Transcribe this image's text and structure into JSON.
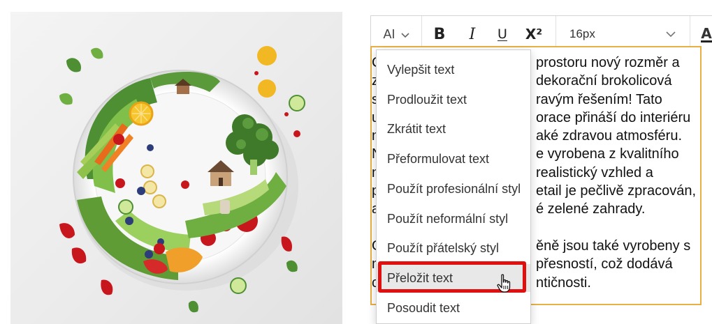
{
  "toolbar": {
    "ai_label": "AI",
    "bold_label": "B",
    "italic_label": "I",
    "underline_label": "U",
    "superscript_label": "X²",
    "font_size": "16px",
    "font_color_label": "A"
  },
  "editor": {
    "lines": [
      "C… prostoru nový rozměr a",
      "z… dekorační brokolicová",
      "s… ravým řešením! Tato",
      "u… orace přináší do interiéru",
      "n… aké zdravou atmosféru.",
      "N… e vyrobena z kvalitního",
      "n… realistický vzhled a",
      "p… etail je pečlivě zpracován,",
      "a… é zelené zahrady.",
      "",
      "O… ěně jsou také vyrobeny s",
      "n… přesností, což dodává",
      "c… ntičnosti."
    ],
    "visible_fragments": [
      {
        "left": "C",
        "right": "prostoru nový rozměr a"
      },
      {
        "left": "z",
        "right": "dekorační brokolicová"
      },
      {
        "left": "s",
        "right": "ravým řešením! Tato"
      },
      {
        "left": "u",
        "right": "orace přináší do interiéru"
      },
      {
        "left": "n",
        "right": "aké zdravou atmosféru."
      },
      {
        "left": "N",
        "right": "e vyrobena z kvalitního"
      },
      {
        "left": "n",
        "right": "realistický vzhled a"
      },
      {
        "left": "p",
        "right": "etail je pečlivě zpracován,"
      },
      {
        "left": "a",
        "right": "é zelené zahrady."
      },
      {
        "left": "",
        "right": ""
      },
      {
        "left": "O",
        "right": "ěně jsou také vyrobeny s"
      },
      {
        "left": "n",
        "right": "přesností, což dodává"
      },
      {
        "left": "c",
        "right": "ntičnosti."
      }
    ]
  },
  "ai_menu": {
    "items": [
      "Vylepšit text",
      "Prodloužit text",
      "Zkrátit text",
      "Přeformulovat text",
      "Použít profesionální styl",
      "Použít neformální styl",
      "Použít přátelský styl",
      "Přeložit text",
      "Posoudit text"
    ],
    "selected_index": 7
  },
  "colors": {
    "editor_border": "#e8b044",
    "highlight": "#e01010",
    "plate_rim": "#ffffff",
    "broccoli": "#3f7a2a",
    "tomato": "#c8161d",
    "lemon": "#f2b824"
  },
  "image": {
    "icon": "vegetable-plate-illustration"
  }
}
